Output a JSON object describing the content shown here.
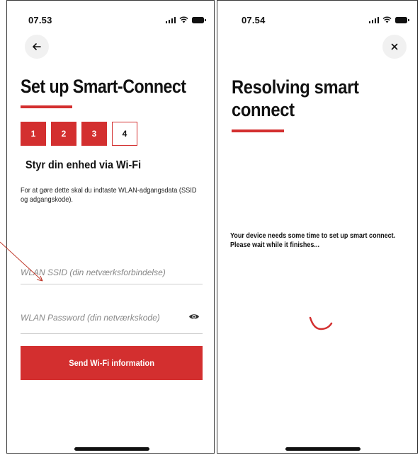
{
  "left_screen": {
    "status_time": "07.53",
    "title": "Set up Smart-Connect",
    "steps": [
      {
        "label": "1",
        "state": "done"
      },
      {
        "label": "2",
        "state": "done"
      },
      {
        "label": "3",
        "state": "done"
      },
      {
        "label": "4",
        "state": "current"
      }
    ],
    "heading": "Styr din enhed via Wi-Fi",
    "description": "For at gøre dette skal du indtaste WLAN-adgangsdata (SSID og adgangskode).",
    "ssid_placeholder": "WLAN SSID (din netværksforbindelse)",
    "password_placeholder": "WLAN Password (din netværkskode)",
    "submit_label": "Send Wi-Fi information"
  },
  "right_screen": {
    "status_time": "07.54",
    "title": "Resolving smart connect",
    "status_message": "Your device needs some time to set up smart connect. Please wait while it finishes..."
  },
  "icons": {
    "back": "arrow-left-icon",
    "close": "close-icon",
    "password_visibility": "eye-icon",
    "loading": "spinner-icon"
  },
  "colors": {
    "accent": "#d32f2f",
    "annotation": "#c0392b",
    "text": "#111111",
    "button_bg": "#f1f1f1"
  }
}
